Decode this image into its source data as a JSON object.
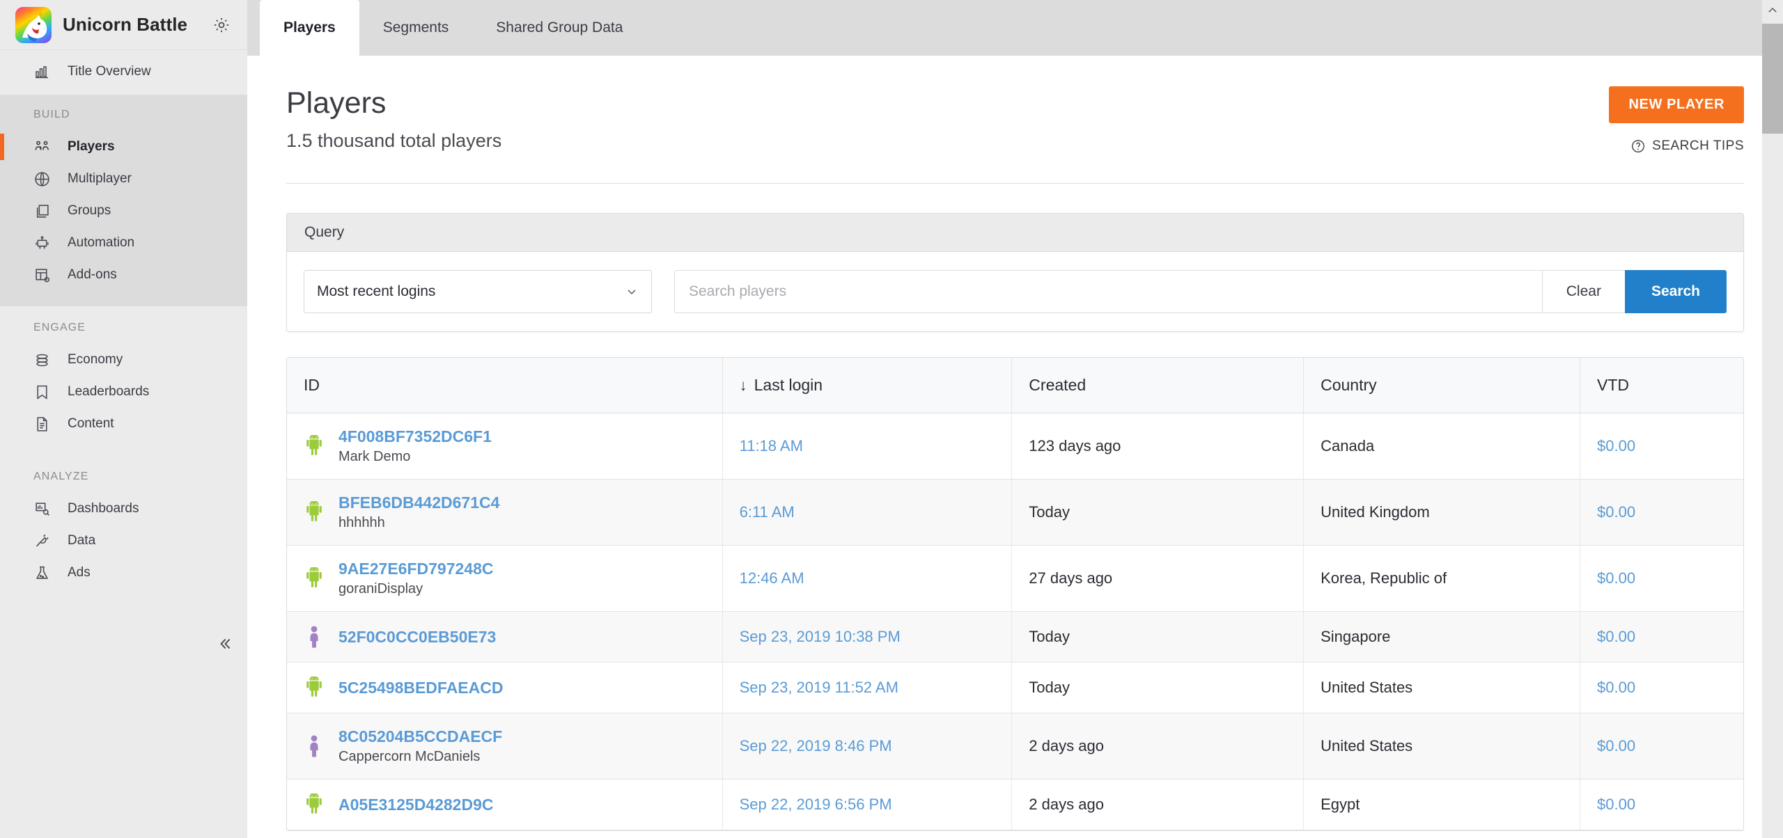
{
  "brand": {
    "title": "Unicorn Battle",
    "logo_icon": "unicorn-logo",
    "settings_icon": "gear-icon"
  },
  "sidebar": {
    "top_items": [
      {
        "label": "Title Overview",
        "icon": "bar-chart-icon"
      }
    ],
    "groups": [
      {
        "label": "BUILD",
        "items": [
          {
            "label": "Players",
            "icon": "people-icon",
            "active": true
          },
          {
            "label": "Multiplayer",
            "icon": "globe-icon",
            "active": false
          },
          {
            "label": "Groups",
            "icon": "layers-icon",
            "active": false
          },
          {
            "label": "Automation",
            "icon": "robot-icon",
            "active": false
          },
          {
            "label": "Add-ons",
            "icon": "addon-grid-icon",
            "active": false
          }
        ]
      },
      {
        "label": "ENGAGE",
        "items": [
          {
            "label": "Economy",
            "icon": "coins-stack-icon",
            "active": false
          },
          {
            "label": "Leaderboards",
            "icon": "bookmark-icon",
            "active": false
          },
          {
            "label": "Content",
            "icon": "document-icon",
            "active": false
          }
        ]
      },
      {
        "label": "ANALYZE",
        "items": [
          {
            "label": "Dashboards",
            "icon": "dashboard-search-icon",
            "active": false
          },
          {
            "label": "Data",
            "icon": "plug-icon",
            "active": false
          },
          {
            "label": "Ads",
            "icon": "flask-icon",
            "active": false
          }
        ]
      }
    ],
    "collapse_icon": "double-chevron-left-icon",
    "active_indicator_color": "#f26722"
  },
  "tabs": [
    {
      "label": "Players",
      "active": true
    },
    {
      "label": "Segments",
      "active": false
    },
    {
      "label": "Shared Group Data",
      "active": false
    }
  ],
  "header": {
    "title": "Players",
    "subtitle": "1.5 thousand total players",
    "new_player_label": "NEW PLAYER",
    "new_player_color": "#f4701f",
    "search_tips_label": "SEARCH TIPS",
    "search_tips_icon": "question-circle-icon"
  },
  "query": {
    "panel_label": "Query",
    "sort_selected": "Most recent logins",
    "sort_caret_icon": "chevron-down-icon",
    "search_placeholder": "Search players",
    "search_value": "",
    "clear_label": "Clear",
    "search_label": "Search",
    "search_button_color": "#2180c9"
  },
  "table": {
    "columns": [
      {
        "label": "ID",
        "sorted": false
      },
      {
        "label": "Last login",
        "sorted": true,
        "sort_icon": "arrow-down-icon"
      },
      {
        "label": "Created",
        "sorted": false
      },
      {
        "label": "Country",
        "sorted": false
      },
      {
        "label": "VTD",
        "sorted": false
      }
    ],
    "rows": [
      {
        "platform": "android-icon",
        "id": "4F008BF7352DC6F1",
        "display_name": "Mark Demo",
        "last_login": "11:18 AM",
        "created": "123 days ago",
        "country": "Canada",
        "vtd": "$0.00"
      },
      {
        "platform": "android-icon",
        "id": "BFEB6DB442D671C4",
        "display_name": "hhhhhh",
        "last_login": "6:11 AM",
        "created": "Today",
        "country": "United Kingdom",
        "vtd": "$0.00"
      },
      {
        "platform": "android-icon",
        "id": "9AE27E6FD797248C",
        "display_name": "goraniDisplay",
        "last_login": "12:46 AM",
        "created": "27 days ago",
        "country": "Korea, Republic of",
        "vtd": "$0.00"
      },
      {
        "platform": "person-icon",
        "id": "52F0C0CC0EB50E73",
        "display_name": "",
        "last_login": "Sep 23, 2019 10:38 PM",
        "created": "Today",
        "country": "Singapore",
        "vtd": "$0.00"
      },
      {
        "platform": "android-icon",
        "id": "5C25498BEDFAEACD",
        "display_name": "",
        "last_login": "Sep 23, 2019 11:52 AM",
        "created": "Today",
        "country": "United States",
        "vtd": "$0.00"
      },
      {
        "platform": "person-icon",
        "id": "8C05204B5CCDAECF",
        "display_name": "Cappercorn McDaniels",
        "last_login": "Sep 22, 2019 8:46 PM",
        "created": "2 days ago",
        "country": "United States",
        "vtd": "$0.00"
      },
      {
        "platform": "android-icon",
        "id": "A05E3125D4282D9C",
        "display_name": "",
        "last_login": "Sep 22, 2019 6:56 PM",
        "created": "2 days ago",
        "country": "Egypt",
        "vtd": "$0.00"
      }
    ]
  },
  "scrollbar": {
    "up_icon": "chevron-up-icon"
  }
}
